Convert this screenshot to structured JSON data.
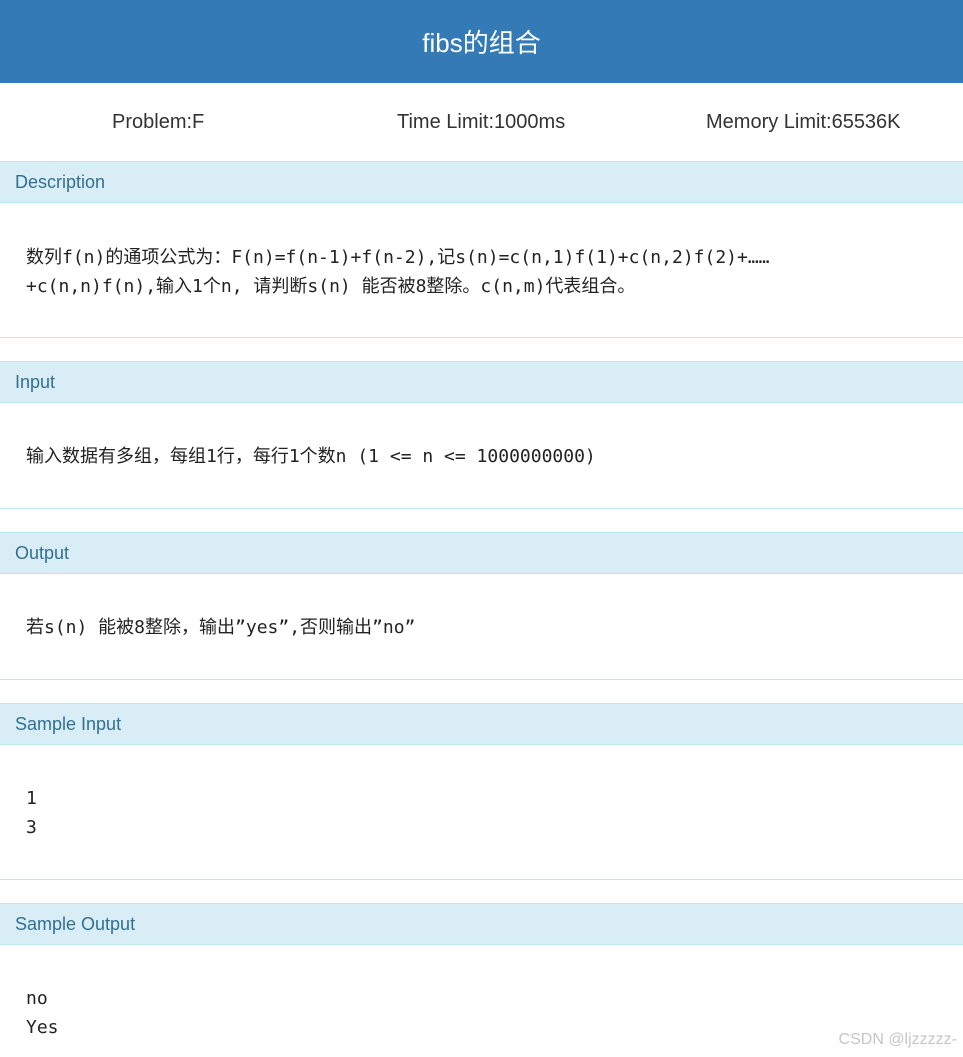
{
  "header": {
    "title": "fibs的组合"
  },
  "meta": {
    "problem": "Problem:F",
    "time_limit": "Time Limit:1000ms",
    "memory_limit": "Memory Limit:65536K"
  },
  "sections": {
    "description": {
      "heading": "Description",
      "line1": "数列f(n)的通项公式为：F(n)=f(n-1)+f(n-2),记s(n)=c(n,1)f(1)+c(n,2)f(2)+……",
      "line2": "+c(n,n)f(n),输入1个n, 请判断s(n) 能否被8整除。c(n,m)代表组合。"
    },
    "input": {
      "heading": "Input",
      "line1": "输入数据有多组，每组1行，每行1个数n (1 <= n <= 1000000000)"
    },
    "output": {
      "heading": "Output",
      "line1": "若s(n) 能被8整除，输出”yes”,否则输出”no”"
    },
    "sample_input": {
      "heading": "Sample Input",
      "line1": "1",
      "line2": "3"
    },
    "sample_output": {
      "heading": "Sample Output",
      "line1": "no",
      "line2": "Yes"
    }
  },
  "watermark": "CSDN @ljzzzzz-",
  "colors": {
    "header_bg": "#337ab7",
    "section_head_bg": "#d9edf7",
    "section_head_text": "#31708f"
  }
}
